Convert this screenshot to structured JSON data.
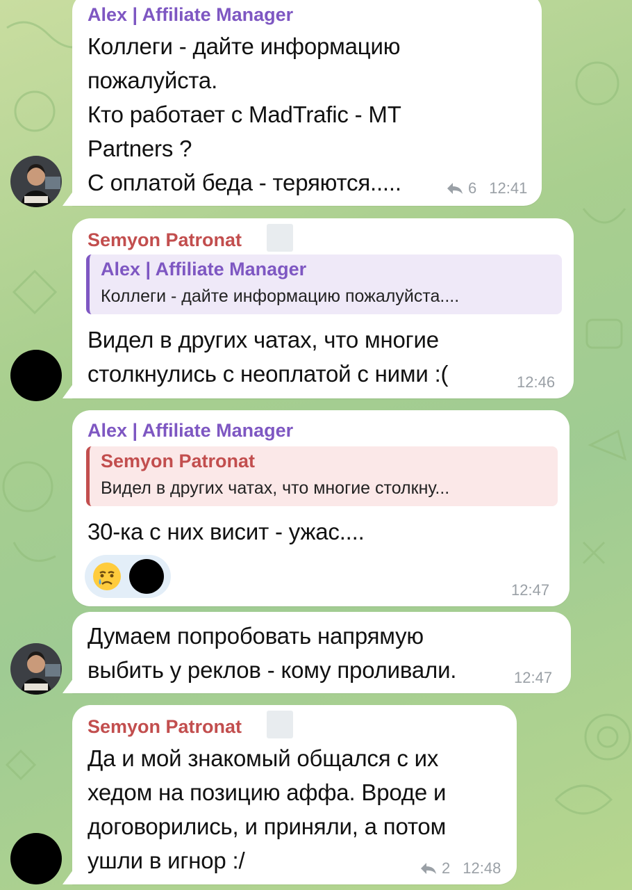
{
  "messages": [
    {
      "sender": "Alex | Affiliate Manager",
      "text": "Коллеги - дайте информацию\nпожалуйста.\nКто работает с MadTrafic - MT\nPartners ?\nС оплатой беда - теряются.....",
      "replies": "6",
      "time": "12:41"
    },
    {
      "sender": "Semyon Patronat",
      "quote": {
        "name": "Alex | Affiliate Manager",
        "text": "Коллеги - дайте информацию пожалуйста...."
      },
      "text": "Видел в других чатах, что многие\nстолкнулись с неоплатой с ними :(",
      "time": "12:46"
    },
    {
      "sender": "Alex | Affiliate Manager",
      "quote": {
        "name": "Semyon Patronat",
        "text": "Видел в других чатах, что многие столкну..."
      },
      "text": "30-ка с них висит - ужас....",
      "reaction_emoji": "crying-face",
      "time": "12:47"
    },
    {
      "text": "Думаем попробовать напрямую\nвыбить у реклов - кому проливали.",
      "time": "12:47"
    },
    {
      "sender": "Semyon Patronat",
      "text": "Да и мой знакомый общался с их\nхедом на позицию аффа. Вроде и\nдоговорились, и приняли, а потом\nушли в игнор :/",
      "replies": "2",
      "time": "12:48"
    }
  ],
  "colors": {
    "alex_name": "#7e57c2",
    "semyon_name": "#c24e4e",
    "bubble": "#ffffff",
    "meta": "#9aa0a6",
    "reaction_bg": "#e3eef8"
  }
}
